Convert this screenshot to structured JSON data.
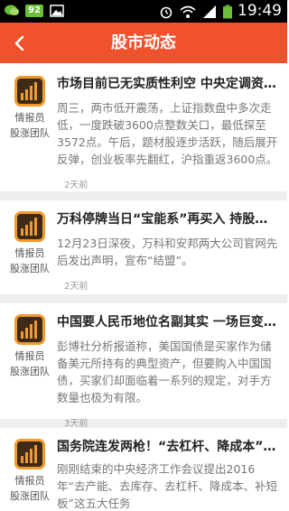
{
  "status_bar": {
    "battery_badge": "92",
    "clock": "19:49"
  },
  "header": {
    "title": "股市动态",
    "back_icon": "chevron-left-icon"
  },
  "articles": [
    {
      "headline": "市场目前已无实质性利空 中央定调资本市场",
      "summary": "周三，两市低开震荡，上证指数盘中多次走低，一度跌破3600点整数关口，最低探至3572点。午后，题材股逐步活跃，随后展开反弹，创业板率先翻红，沪指重返3600点。",
      "author_line1": "情报员",
      "author_line2": "股涨团队",
      "time": "2天前"
    },
    {
      "headline": "万科停牌当日“宝能系”再买入 持股比例升至",
      "summary": "12月23日深夜，万科和安邦两大公司官网先后发出声明，宣布“结盟”。",
      "author_line1": "情报员",
      "author_line2": "股涨团队",
      "time": "2天前"
    },
    {
      "headline": "中国要人民币地位名副其实 一场巨变马上来",
      "summary": "彭博社分析报道称，美国国债是买家作为储备美元所持有的典型资产，但要购入中国国债，买家们却面临着一系列的规定，对手方数量也极为有限。",
      "author_line1": "情报员",
      "author_line2": "股涨团队",
      "time": "3天前"
    },
    {
      "headline": "国务院连发两枪！“去杠杆、降成本”任务明确",
      "summary": "刚刚结束的中央经济工作会议提出2016年“去产能、去库存、去杠杆、降成本、补短板”这五大任务",
      "author_line1": "情报员",
      "author_line2": "股涨团队",
      "time": ""
    }
  ]
}
